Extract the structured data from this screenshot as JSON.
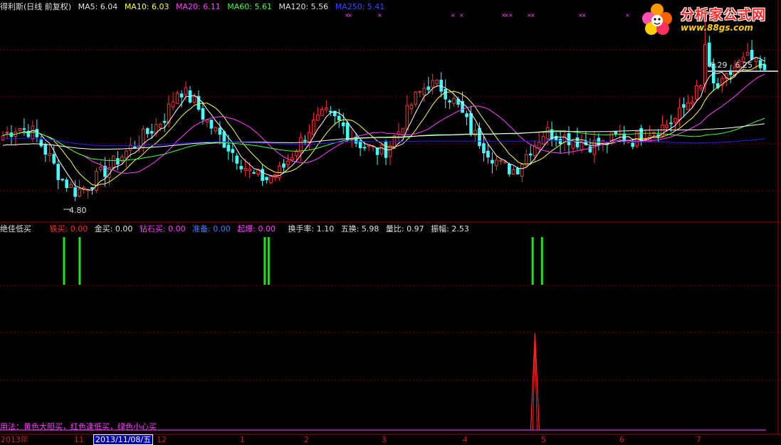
{
  "main_header": {
    "stock_label": "得利斯(日线 前复权)",
    "ma5": "MA5: 6.04",
    "ma10": "MA10: 6.03",
    "ma20": "MA20: 6.11",
    "ma60": "MA60: 5.61",
    "ma120": "MA120: 5.56",
    "ma250": "MA250: 5.41"
  },
  "colors": {
    "ma5": "#ffffff",
    "ma10": "#ffff40",
    "ma20": "#ff40ff",
    "ma60": "#40ff40",
    "ma120": "#ffffff",
    "ma250": "#2020ff",
    "up": "#ff3030",
    "down": "#40ffff",
    "grid": "#800000",
    "buy_signal": "#20e020",
    "spike": "#ff2020"
  },
  "price_annotations": {
    "low_label": "4.80",
    "range_label": "6.29 - 6.25"
  },
  "indicator_header": {
    "name": "绝佳低买",
    "tie_mai": "铁买: 0.00",
    "jin_mai": "金买: 0.00",
    "zuanshi_mai": "钻石买: 0.00",
    "zhunbei": "准备: 0.00",
    "qibao": "起爆: 0.00",
    "turnover": "换手率: 1.10",
    "five_turnover": "五换: 5.98",
    "volume_ratio": "量比: 0.97",
    "amplitude": "振幅: 2.53"
  },
  "usage_note": "用法：黄色大胆买，红色逢低买，绿色小心买",
  "time_axis": {
    "year_label": "2013年",
    "ticks": [
      "11",
      "12",
      "1",
      "2",
      "3",
      "4",
      "5",
      "6",
      "7"
    ],
    "cursor_date": "2013/11/08/五"
  },
  "logo": {
    "name": "分析家公式网",
    "url": "www.88gs.com",
    "icon": "flower-logo-icon"
  },
  "chart_data": [
    {
      "type": "candlestick",
      "title": "得利斯(日线 前复权)",
      "ylim": [
        4.6,
        6.9
      ],
      "grid": true,
      "series": [
        {
          "name": "MA5",
          "last": 6.04
        },
        {
          "name": "MA10",
          "last": 6.03
        },
        {
          "name": "MA20",
          "last": 6.11
        },
        {
          "name": "MA60",
          "last": 5.61
        },
        {
          "name": "MA120",
          "last": 5.56
        },
        {
          "name": "MA250",
          "last": 5.41
        }
      ],
      "close_path": [
        5.5,
        5.6,
        5.55,
        5.3,
        5.0,
        4.85,
        4.95,
        5.1,
        5.25,
        5.4,
        5.55,
        5.7,
        6.05,
        5.9,
        5.65,
        5.45,
        5.25,
        5.05,
        5.0,
        5.1,
        5.35,
        5.6,
        5.75,
        5.65,
        5.45,
        5.35,
        5.3,
        5.55,
        5.9,
        6.1,
        6.05,
        5.85,
        5.55,
        5.35,
        5.15,
        5.1,
        5.35,
        5.55,
        5.5,
        5.45,
        5.4,
        5.4,
        5.5,
        5.45,
        5.55,
        5.6,
        5.7,
        5.95,
        6.1,
        6.05,
        6.3,
        6.4,
        6.2
      ]
    },
    {
      "type": "bar",
      "title": "绝佳低买",
      "series": [
        {
          "name": "钻石买",
          "positions": [
            0.082,
            0.102,
            0.339,
            0.344,
            0.682,
            0.694
          ]
        }
      ]
    },
    {
      "type": "line",
      "series": [
        {
          "name": "起爆",
          "spike_position": 0.685
        }
      ]
    }
  ]
}
